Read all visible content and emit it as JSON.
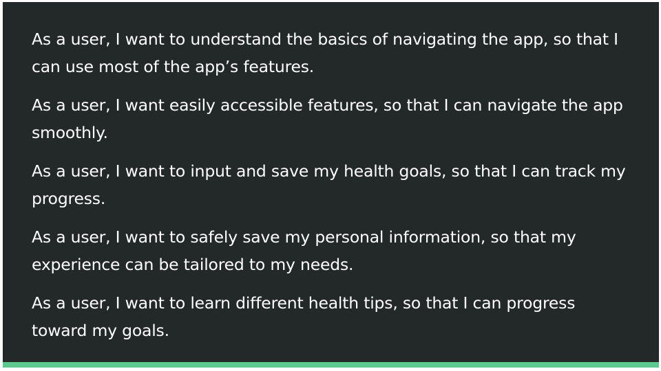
{
  "stories": [
    "As a user, I want to understand the basics of navigating the app, so that I can use most of the app’s features.",
    "As a user, I want easily accessible features, so that I can navigate the app smoothly.",
    "As a user, I want to input and save my health goals, so that I can track my progress.",
    "As a user, I want to safely save my personal information, so that my experience can be tailored to my needs.",
    "As a user, I want to learn different health tips, so that I can progress toward my goals."
  ],
  "colors": {
    "background": "#232829",
    "text": "#ffffff",
    "accent": "#5dc991"
  }
}
